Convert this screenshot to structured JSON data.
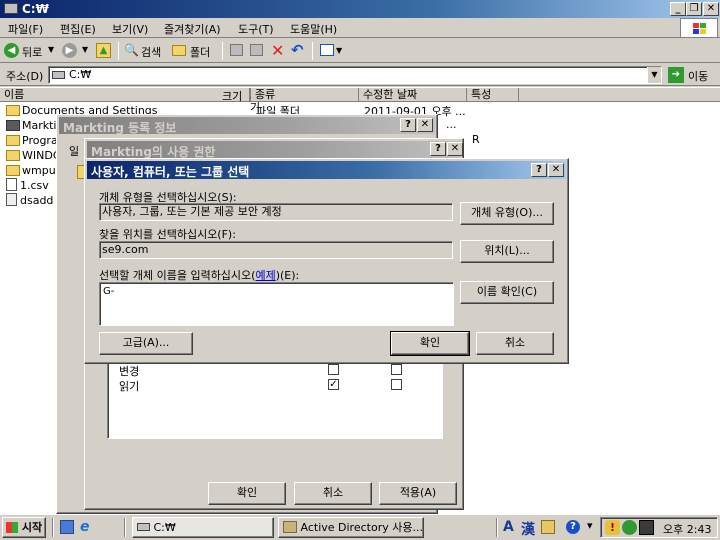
{
  "explorer": {
    "title": "C:₩",
    "menu": [
      "파일(F)",
      "편집(E)",
      "보기(V)",
      "즐겨찾기(A)",
      "도구(T)",
      "도움말(H)"
    ],
    "toolbar": {
      "back": "뒤로",
      "search": "검색",
      "folders": "폴더"
    },
    "address_label": "주소(D)",
    "address_value": "C:₩",
    "go_label": "이동",
    "columns": [
      "이름",
      "크기",
      "종류",
      "수정한 날짜",
      "특성"
    ],
    "files": [
      {
        "name": "Documents and Settings",
        "type": "파일 폴더",
        "modified": "2011-09-01 오후 ..."
      },
      {
        "name": "Marktin",
        "type": "",
        "modified": ""
      },
      {
        "name": "Progra",
        "type": "",
        "modified": ""
      },
      {
        "name": "WINDC",
        "type": "",
        "modified": ""
      },
      {
        "name": "wmpul",
        "type": "",
        "modified": ""
      },
      {
        "name": "1.csv",
        "type": "",
        "modified": ""
      },
      {
        "name": "dsadd",
        "type": "",
        "modified": ""
      }
    ],
    "attr_r": "R",
    "dots": "..."
  },
  "props_dialog": {
    "title": "Markting 등록 정보",
    "tab_peek": "일"
  },
  "perm_dialog": {
    "title": "Markting의 사용 권한",
    "rows": [
      {
        "label": "변경",
        "allow": false,
        "deny": false
      },
      {
        "label": "읽기",
        "allow": true,
        "deny": false
      }
    ],
    "ok": "확인",
    "cancel": "취소",
    "apply": "적용(A)"
  },
  "select_dialog": {
    "title": "사용자, 컴퓨터, 또는 그룹 선택",
    "object_type_label": "개체 유형을 선택하십시오(S):",
    "object_type_value": "사용자, 그룹, 또는 기본 제공 보안 계정",
    "object_type_button": "개체 유형(O)...",
    "location_label": "찾을 위치를 선택하십시오(F):",
    "location_value": "se9.com",
    "location_button": "위치(L)...",
    "names_label_pre": "선택할 개체 이름을 입력하십시오(",
    "names_label_link": "예제",
    "names_label_post": ")(E):",
    "names_value": "G-",
    "check_names_button": "이름 확인(C)",
    "advanced_button": "고급(A)...",
    "ok": "확인",
    "cancel": "취소"
  },
  "taskbar": {
    "start": "시작",
    "tasks": [
      "C:₩",
      "Active Directory 사용..."
    ],
    "ime_a": "A",
    "ime_han": "漢",
    "clock": "오후 2:43"
  }
}
